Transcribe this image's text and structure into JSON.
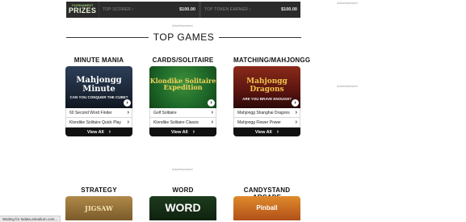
{
  "tournament": {
    "logo_small": "TOURNAMENT",
    "logo_big": "PRIZES",
    "cells": [
      {
        "label": "TOP SCORER ›",
        "value": "$100.00"
      },
      {
        "label": "TOP TOKEN EARNER ›",
        "value": "$100.00"
      }
    ]
  },
  "ads": {
    "right_top": "Advertisement",
    "above_top_games": "Advertisement",
    "right_mid": "Advertisement",
    "between_rows": "Advertisement"
  },
  "top_games": {
    "title": "TOP GAMES"
  },
  "categories": [
    {
      "title": "MINUTE MANIA",
      "thumb_line1": "Mahjongg Minute",
      "thumb_line2": "CAN YOU CONQUER THE CUBE?",
      "games": [
        "60 Second Word Finder",
        "Klondike Solitaire Quick Play"
      ],
      "view_all": "View All"
    },
    {
      "title": "CARDS/SOLITAIRE",
      "thumb_line1": "Klondike Solitaire Expedition",
      "thumb_line2": "",
      "games": [
        "Golf Solitaire",
        "Klondike Solitaire Classic"
      ],
      "view_all": "View All"
    },
    {
      "title": "MATCHING/MAHJONGG",
      "thumb_line1": "Mahjongg Dragons",
      "thumb_line2": "ARE YOU BRAVE ENOUGH?",
      "games": [
        "Mahjongg Shanghai Dragons",
        "Mahjongg Flower Power"
      ],
      "view_all": "View All"
    }
  ],
  "categories_row2": [
    {
      "title": "STRATEGY",
      "thumb_line1": "JIGSAW"
    },
    {
      "title": "WORD",
      "thumb_line1": "WORD"
    },
    {
      "title": "CANDYSTAND ARCADE",
      "thumb_line1": "Pinball"
    }
  ],
  "status_bar": {
    "text": "Waiting for tsdata.arkadium.com..."
  },
  "colors": {
    "tournament_bg": "#2b2b2b",
    "tournament_accent": "#9bd36a",
    "view_all_bg": "#111111",
    "thumb_minute": "#1f2a3a",
    "thumb_cards": "#1f6b2a",
    "thumb_mahjongg": "#6a1a1a"
  }
}
